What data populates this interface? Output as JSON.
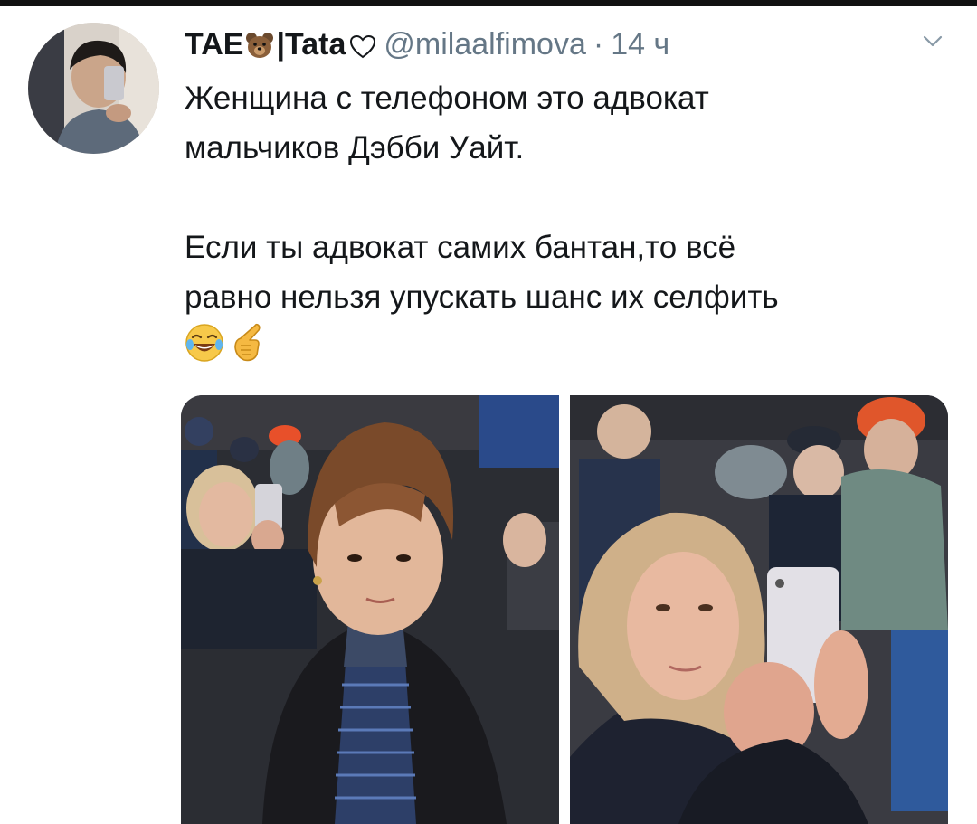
{
  "tweet": {
    "display_name_prefix": "TAE",
    "display_name_suffix": "Tata",
    "name_separator": "|",
    "handle": "@milaalfimova",
    "separator": "·",
    "time": "14 ч",
    "body": {
      "paragraph_1_line_1": "Женщина с телефоном это адвокат",
      "paragraph_1_line_2": "мальчиков Дэбби Уайт.",
      "paragraph_2_line_1": "Если ты адвокат самих бантан,то всё",
      "paragraph_2_line_2": "равно нельзя упускать шанс их селфить"
    },
    "emojis": [
      "laughing-tears-emoji",
      "pointing-hand-emoji"
    ],
    "header_icons": [
      "bear-emoji",
      "heart-outline-icon"
    ],
    "menu_icon": "chevron-down-icon",
    "media": [
      {
        "name": "photo-young-man-in-crowd"
      },
      {
        "name": "photo-woman-taking-selfie"
      }
    ]
  },
  "colors": {
    "text_primary": "#14171a",
    "text_secondary": "#657786",
    "top_bar": "#111111"
  }
}
